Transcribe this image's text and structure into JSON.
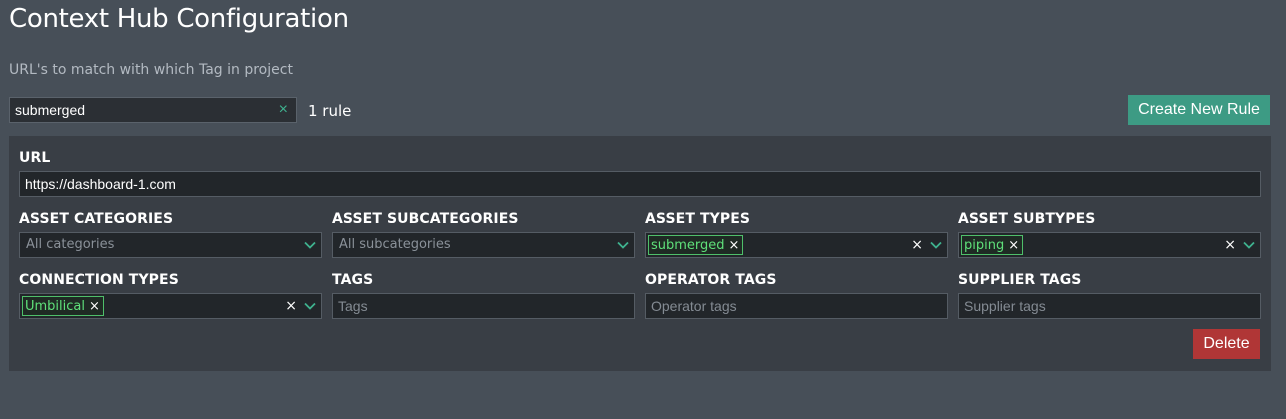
{
  "header": {
    "title": "Context Hub Configuration",
    "subtitle": "URL's to match with which Tag in project"
  },
  "search": {
    "value": "submerged",
    "clear_icon": "×"
  },
  "rule_count": "1 rule",
  "create_button": "Create New Rule",
  "colors": {
    "accent": "#3d9b84",
    "chip_border": "#4fbf6a",
    "danger": "#b03636",
    "background": "#474f58",
    "card": "#393e45"
  },
  "rule": {
    "url": {
      "label": "URL",
      "value": "https://dashboard-1.com"
    },
    "asset_categories": {
      "label": "ASSET CATEGORIES",
      "placeholder": "All categories"
    },
    "asset_subcategories": {
      "label": "ASSET SUBCATEGORIES",
      "placeholder": "All subcategories"
    },
    "asset_types": {
      "label": "ASSET TYPES",
      "chips": [
        "submerged"
      ]
    },
    "asset_subtypes": {
      "label": "ASSET SUBTYPES",
      "chips": [
        "piping"
      ]
    },
    "connection_types": {
      "label": "CONNECTION TYPES",
      "chips": [
        "Umbilical"
      ]
    },
    "tags": {
      "label": "TAGS",
      "placeholder": "Tags"
    },
    "operator_tags": {
      "label": "OPERATOR TAGS",
      "placeholder": "Operator tags"
    },
    "supplier_tags": {
      "label": "SUPPLIER TAGS",
      "placeholder": "Supplier tags"
    },
    "chip_remove_icon": "×",
    "clear_icon": "×",
    "delete_button": "Delete"
  }
}
